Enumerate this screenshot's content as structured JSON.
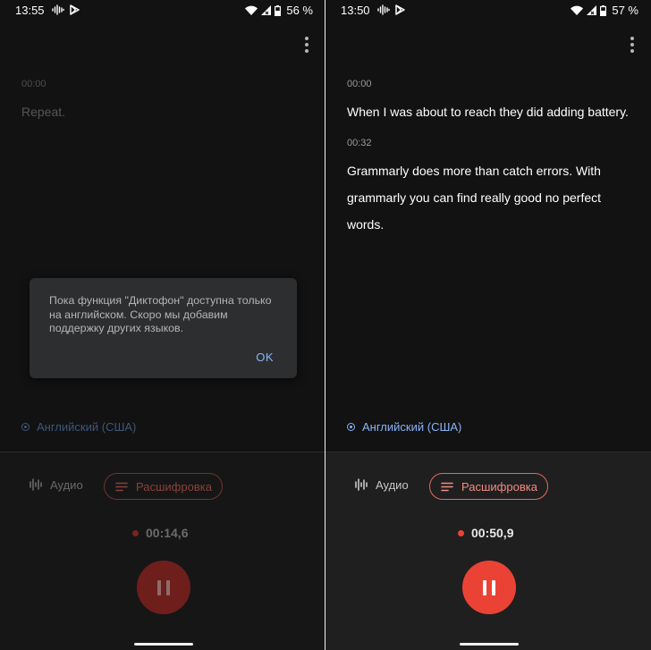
{
  "left": {
    "status": {
      "time": "13:55",
      "battery": "56 %"
    },
    "transcript": [
      {
        "time": "00:00",
        "text": "Repeat."
      }
    ],
    "dialog": {
      "message": "Пока функция \"Диктофон\" доступна только на английском. Скоро мы добавим поддержку других языков.",
      "ok_label": "OK"
    },
    "language": "Английский (США)",
    "tabs": {
      "audio": "Аудио",
      "transcription": "Расшифровка"
    },
    "timer": "00:14,6"
  },
  "right": {
    "status": {
      "time": "13:50",
      "battery": "57 %"
    },
    "transcript": [
      {
        "time": "00:00",
        "text": "When I was about to reach they did adding battery."
      },
      {
        "time": "00:32",
        "text": "Grammarly does more than catch errors. With grammarly you can find really good no perfect words."
      }
    ],
    "language": "Английский (США)",
    "tabs": {
      "audio": "Аудио",
      "transcription": "Расшифровка"
    },
    "timer": "00:50,9"
  },
  "icons": {
    "status_left": [
      "soundwave-icon",
      "play-store-icon"
    ],
    "status_right": [
      "wifi-icon",
      "cell-signal-icon",
      "battery-icon"
    ],
    "menu": "more-vert-icon",
    "audio_tab": "waveform-icon",
    "transcription_tab": "notes-icon",
    "record_control": "pause-icon"
  },
  "colors": {
    "accent": "#ea4335",
    "accent_light": "#f28b82",
    "link": "#8ab4f8",
    "background": "#121212"
  }
}
